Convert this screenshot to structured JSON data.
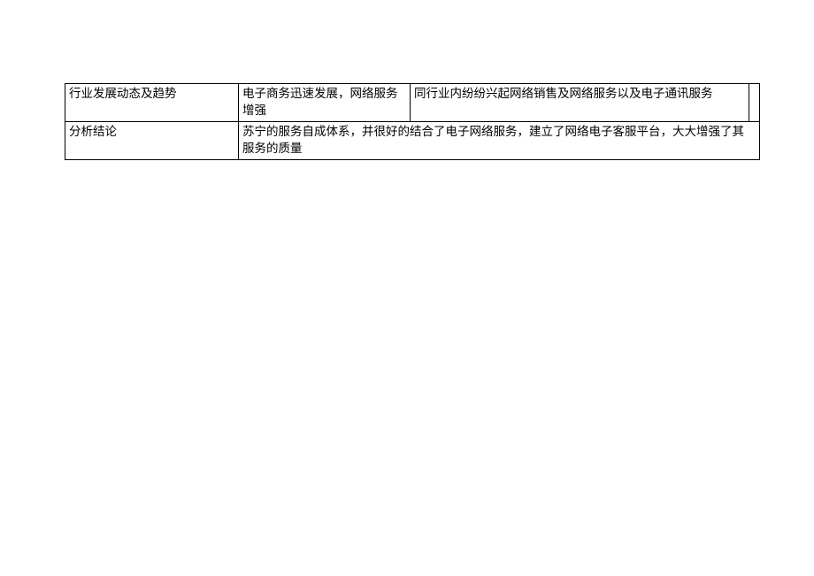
{
  "table": {
    "row1": {
      "label": "行业发展动态及趋势",
      "mid": "电子商务迅速发展，网络服务增强",
      "right": "同行业内纷纷兴起网络销售及网络服务以及电子通讯服务",
      "extra": ""
    },
    "row2": {
      "label": "分析结论",
      "content": "苏宁的服务自成体系，并很好的结合了电子网络服务，建立了网络电子客服平台，大大增强了其服务的质量"
    }
  }
}
